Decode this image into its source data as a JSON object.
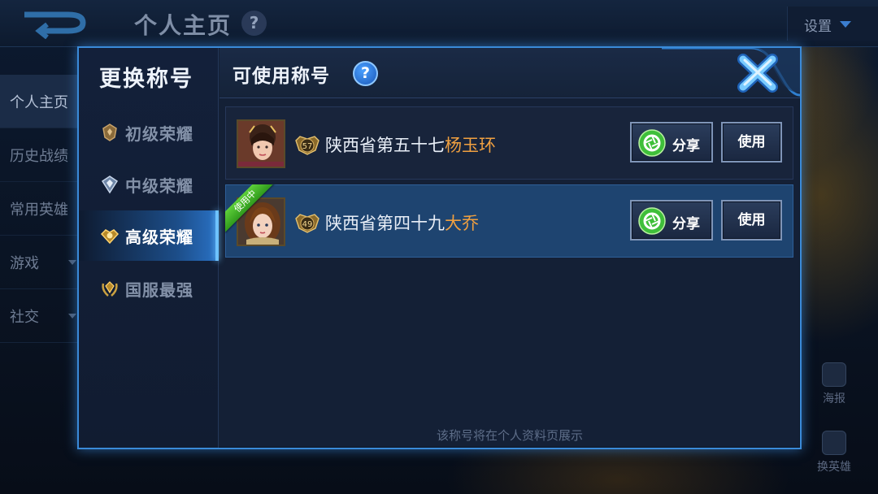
{
  "background": {
    "page_title": "个人主页",
    "help_glyph": "?",
    "settings_label": "设置",
    "left_nav": [
      {
        "label": "个人主页",
        "active": true
      },
      {
        "label": "历史战绩",
        "active": false
      },
      {
        "label": "常用英雄",
        "active": false
      },
      {
        "label": "游戏",
        "active": false
      },
      {
        "label": "社交",
        "active": false
      }
    ],
    "side_buttons": {
      "poster_label": "海报",
      "change_hero_label": "换英雄"
    }
  },
  "modal": {
    "left_title": "更换称号",
    "header_title": "可使用称号",
    "help_glyph": "?",
    "ranks": [
      {
        "label": "初级荣耀",
        "active": false,
        "icon": "bronze-crest-icon"
      },
      {
        "label": "中级荣耀",
        "active": false,
        "icon": "silver-crest-icon"
      },
      {
        "label": "高级荣耀",
        "active": true,
        "icon": "gold-crest-icon"
      },
      {
        "label": "国服最强",
        "active": false,
        "icon": "laurel-crest-icon"
      }
    ],
    "titles": [
      {
        "level": "57",
        "prefix": "陕西省第五十七",
        "hero": "杨玉环",
        "in_use": false,
        "share_label": "分享",
        "use_label": "使用"
      },
      {
        "level": "49",
        "prefix": "陕西省第四十九",
        "hero": "大乔",
        "in_use": true,
        "in_use_label": "使用中",
        "share_label": "分享",
        "use_label": "使用"
      }
    ],
    "footer_note": "该称号将在个人资料页展示"
  },
  "colors": {
    "accent_blue": "#3a8ad8",
    "hero_name": "#f0a040",
    "in_use_green": "#4cc22c"
  }
}
